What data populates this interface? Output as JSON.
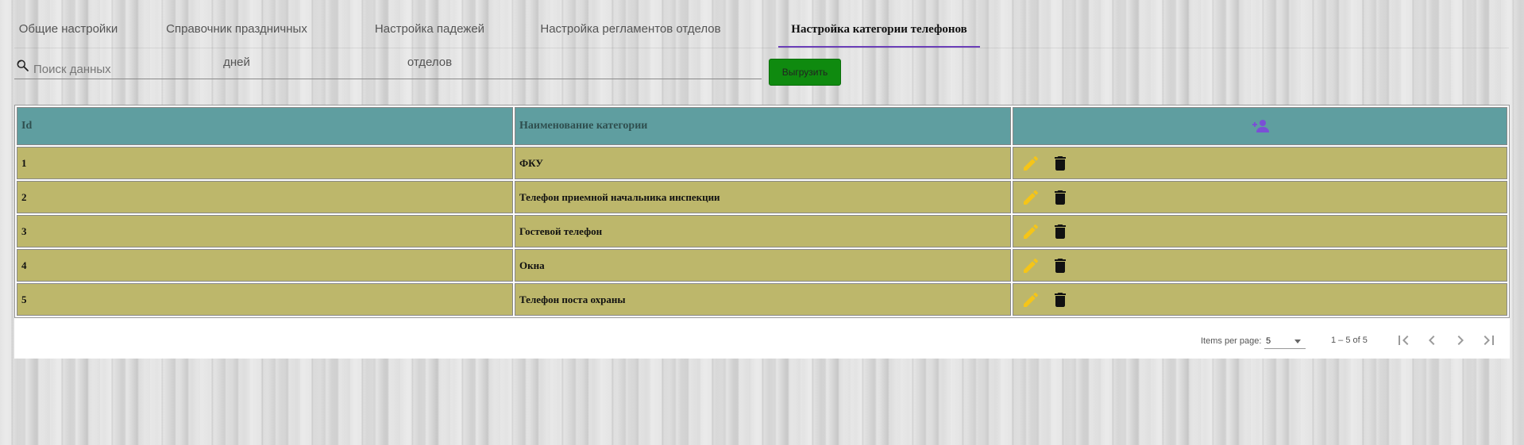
{
  "tabs": [
    {
      "label": "Общие настройки"
    },
    {
      "label": "Справочник праздничных дней"
    },
    {
      "label": "Настройка падежей отделов"
    },
    {
      "label": "Настройка регламентов отделов"
    },
    {
      "label": "Настройка категории телефонов",
      "active": true
    }
  ],
  "search": {
    "placeholder": "Поиск данных",
    "value": ""
  },
  "export_button": {
    "label": "Выгрузить",
    "color": "#0f8a0f"
  },
  "table": {
    "headers": {
      "id": "Id",
      "name": "Наименование категории",
      "add_icon": "person-add-icon"
    },
    "rows": [
      {
        "id": "1",
        "name": "ФКУ"
      },
      {
        "id": "2",
        "name": "Телефон приемной начальника инспекции"
      },
      {
        "id": "3",
        "name": "Гостевой телефон"
      },
      {
        "id": "4",
        "name": "Окна"
      },
      {
        "id": "5",
        "name": "Телефон поста охраны"
      }
    ],
    "row_actions": [
      "edit-icon",
      "delete-icon"
    ]
  },
  "paginator": {
    "items_per_page_label": "Items per page:",
    "page_size": "5",
    "range_label": "1 – 5 of 5"
  },
  "colors": {
    "header_bg": "#5f9ea0",
    "row_bg": "#bdb76b",
    "tab_indicator": "#6b3fb8",
    "add_icon": "#7b4fd6",
    "edit_icon": "#f5c518"
  }
}
